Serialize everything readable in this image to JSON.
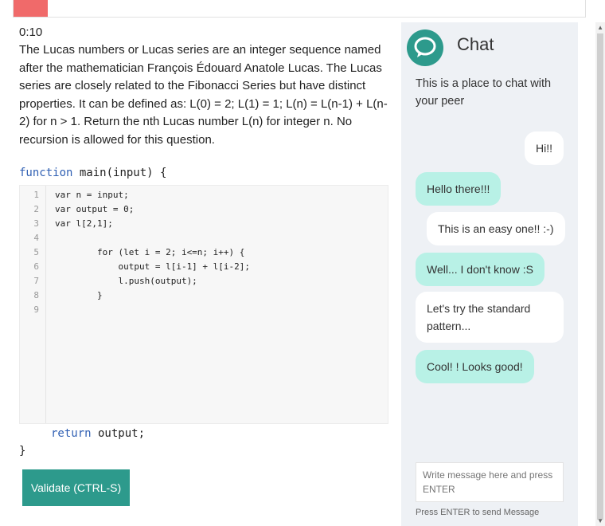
{
  "progress": {
    "fraction": 0.06,
    "color": "#f06a6a"
  },
  "timer": "0:10",
  "question": "The Lucas numbers or Lucas series are an integer sequence named after the mathematician François Édouard Anatole Lucas. The Lucas series are closely related to the Fibonacci Series but have distinct properties. It can be defined as: L(0) = 2; L(1) = 1; L(n) = L(n-1) + L(n-2) for n > 1. Return the nth Lucas number L(n) for integer n. No recursion is allowed for this question.",
  "function_header": {
    "keyword": "function",
    "signature": " main(input) {"
  },
  "editor": {
    "lines": [
      {
        "num": "1",
        "text": "var n = input;"
      },
      {
        "num": "2",
        "text": "var output = 0;"
      },
      {
        "num": "3",
        "text": "var l[2,1];"
      },
      {
        "num": "4",
        "text": ""
      },
      {
        "num": "5",
        "text": "        for (let i = 2; i<=n; i++) {"
      },
      {
        "num": "6",
        "text": "            output = l[i-1] + l[i-2];"
      },
      {
        "num": "7",
        "text": "            l.push(output);"
      },
      {
        "num": "8",
        "text": "        }"
      },
      {
        "num": "9",
        "text": ""
      }
    ]
  },
  "return_line": {
    "keyword": "return",
    "rest": " output;"
  },
  "closing_brace": "}",
  "validate_label": "Validate (CTRL-S)",
  "chat": {
    "title": "Chat",
    "description": "This is a place to chat with your peer",
    "messages": [
      {
        "from": "me",
        "text": "Hi!!"
      },
      {
        "from": "peer",
        "text": "Hello there!!!"
      },
      {
        "from": "me",
        "text": "This is an easy one!! :-)"
      },
      {
        "from": "peer",
        "text": "Well... I don't know :S"
      },
      {
        "from": "me",
        "text": "Let's try the standard pattern..."
      },
      {
        "from": "peer",
        "text": "Cool! ! Looks good!"
      }
    ],
    "input_placeholder": "Write message here and press ENTER",
    "hint": "Press ENTER to send Message"
  },
  "colors": {
    "accent": "#2d9a8c",
    "peer_bubble": "#b8f1e6",
    "keyword": "#2f5fb3"
  }
}
